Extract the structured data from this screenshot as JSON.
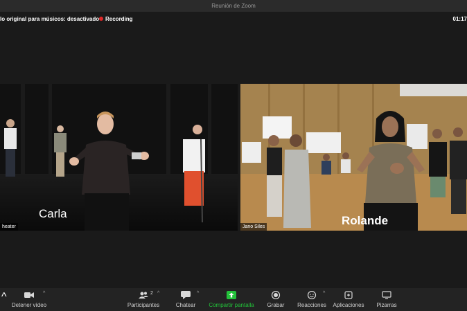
{
  "window": {
    "title": "Reunión de Zoom"
  },
  "topbar": {
    "original_sound": "lo original para músicos: desactivado",
    "recording": "Recording",
    "timer": "01:17"
  },
  "participants": [
    {
      "overlay_name": "Carla",
      "tag": "heater"
    },
    {
      "overlay_name": "Rolande",
      "tag": "Jano Siles"
    }
  ],
  "toolbar": {
    "video": "Detener vídeo",
    "participants": "Participantes",
    "participants_count": "2",
    "chat": "Chatear",
    "share": "Compartir pantalla",
    "record": "Grabar",
    "reactions": "Reacciones",
    "apps": "Aplicaciones",
    "whiteboards": "Pizarras"
  },
  "colors": {
    "share_green": "#23c13a",
    "recording_red": "#e02828"
  }
}
